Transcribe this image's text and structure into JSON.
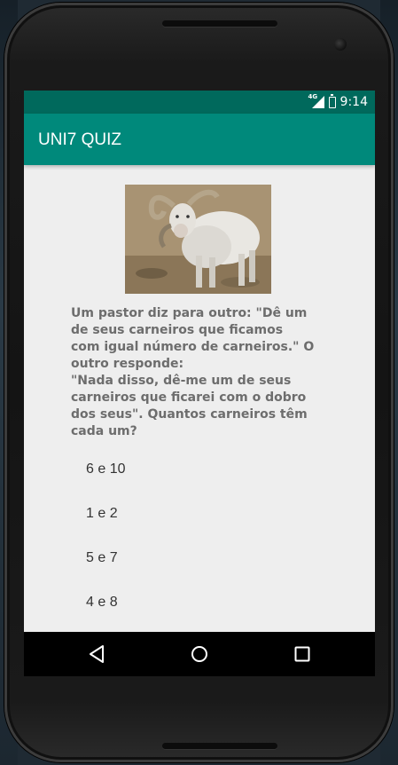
{
  "status_bar": {
    "network_label": "4G",
    "time": "9:14"
  },
  "app_bar": {
    "title": "UNI7 QUIZ"
  },
  "question": {
    "image_alt": "sheep-photo",
    "text": "Um pastor diz para outro: \"Dê um\nde seus carneiros que ficamos\ncom igual número de carneiros.\" O\noutro responde:\n\"Nada disso, dê-me um de seus\ncarneiros que ficarei com o dobro\ndos seus\". Quantos carneiros têm\ncada um?"
  },
  "options": [
    {
      "label": "6 e 10"
    },
    {
      "label": "1 e 2"
    },
    {
      "label": "5 e 7"
    },
    {
      "label": "4 e 8"
    }
  ],
  "nav_bar": {
    "icons": [
      "back-icon",
      "home-icon",
      "recents-icon"
    ]
  },
  "colors": {
    "status_bar": "#00695c",
    "app_bar": "#00897b",
    "background": "#eeeeee"
  }
}
